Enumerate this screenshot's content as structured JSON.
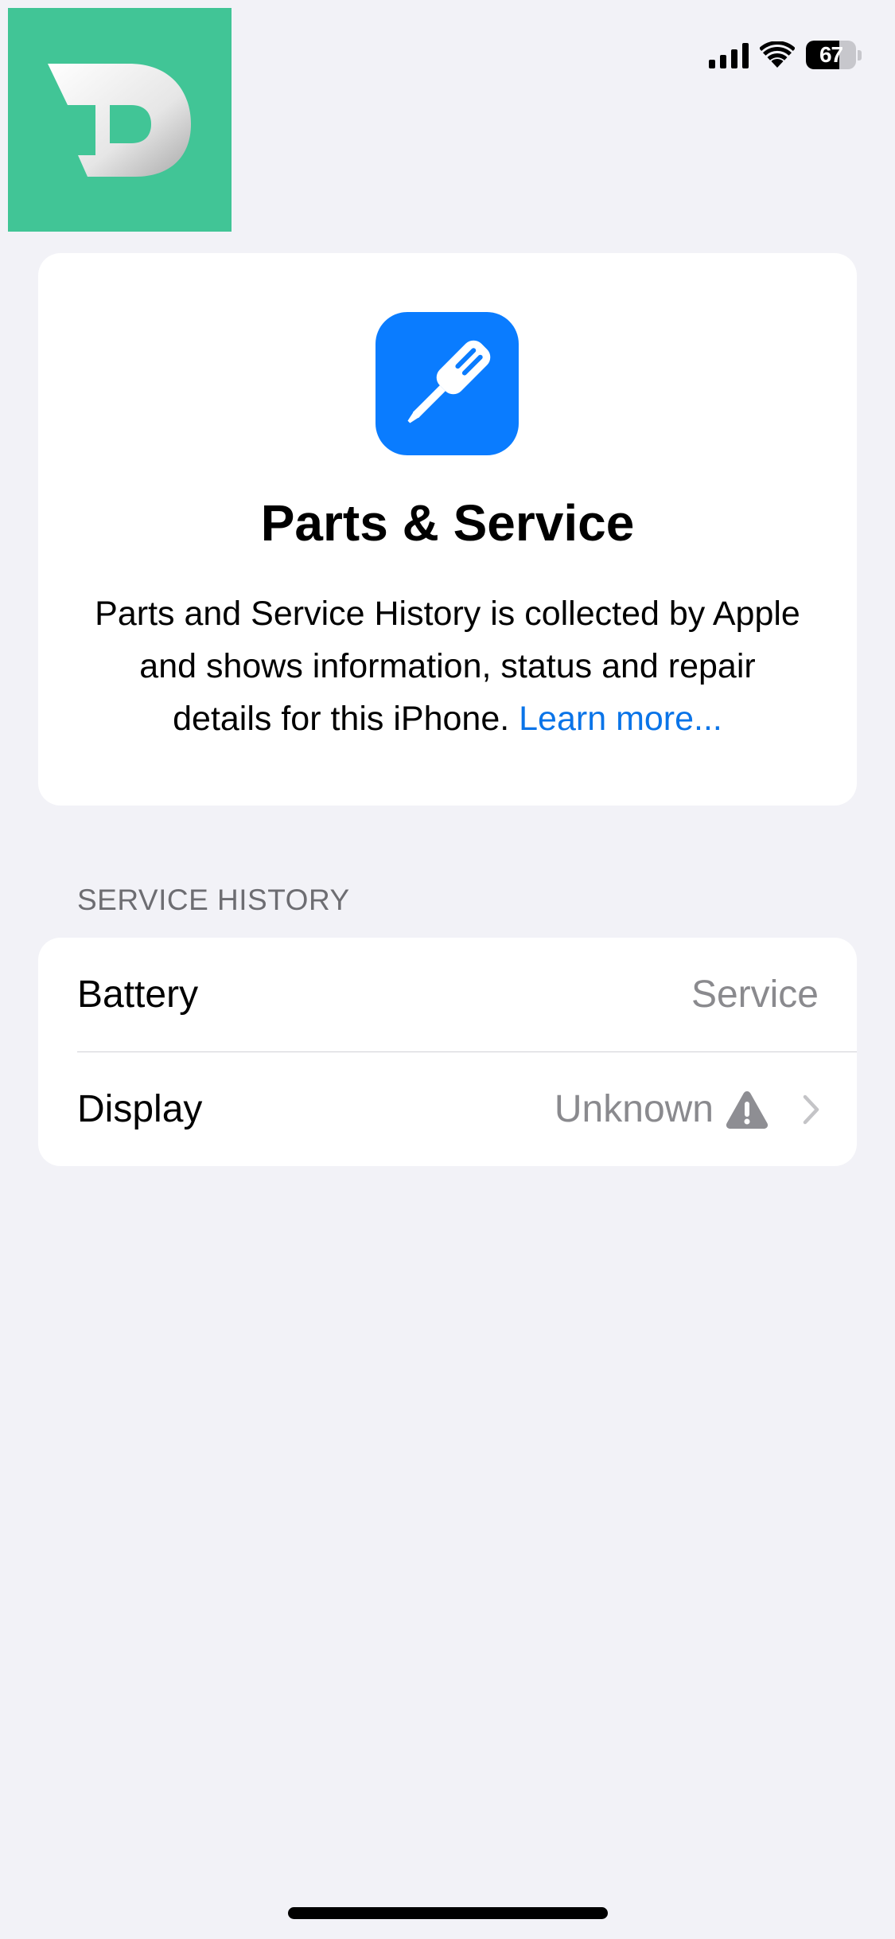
{
  "status_bar": {
    "battery_level": "67",
    "battery_fraction": 0.67,
    "icons": [
      "signal-icon",
      "wifi-icon",
      "battery-icon"
    ]
  },
  "watermark": {
    "icon": "d-logo-icon",
    "background_color": "#41c596"
  },
  "hero": {
    "icon": "screwdriver-icon",
    "icon_color": "#0a7cff",
    "title": "Parts & Service",
    "description": "Parts and Service History is collected by Apple and shows information, status and repair details for this iPhone.",
    "link_label": "Learn more..."
  },
  "service_history": {
    "header": "SERVICE HISTORY",
    "rows": [
      {
        "label": "Battery",
        "value": "Service"
      },
      {
        "label": "Display",
        "value": "Unknown",
        "icon": "warning-icon",
        "has_chevron": true
      }
    ]
  },
  "colors": {
    "background": "#f2f2f7",
    "card": "#ffffff",
    "accent_link": "#0a74e8",
    "secondary_text": "#8a8a8e",
    "section_header": "#6d6d72"
  }
}
